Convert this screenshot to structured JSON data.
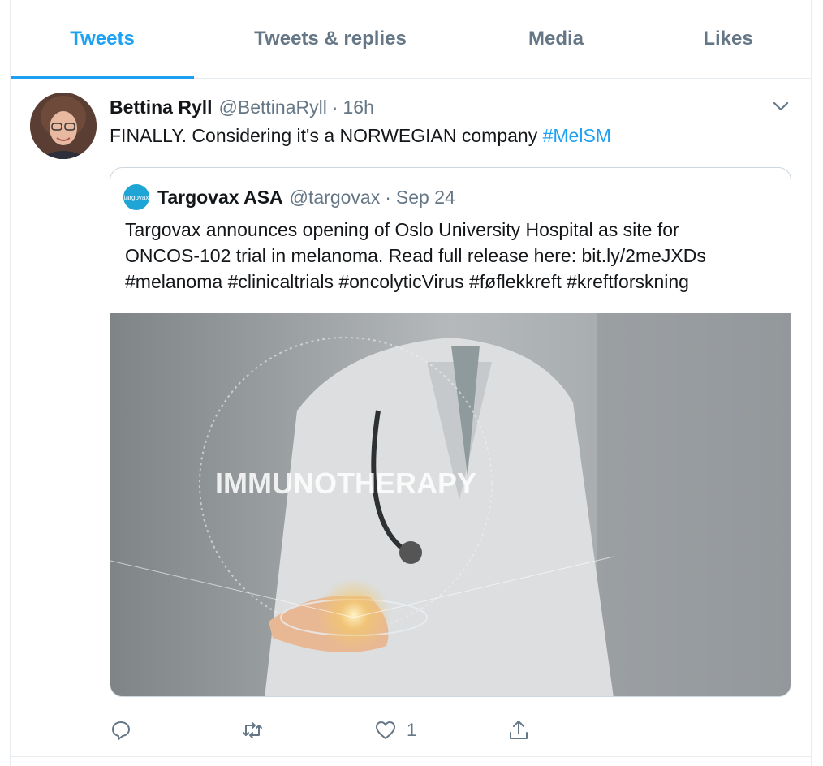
{
  "tabs": [
    {
      "label": "Tweets",
      "active": true
    },
    {
      "label": "Tweets & replies",
      "active": false
    },
    {
      "label": "Media",
      "active": false
    },
    {
      "label": "Likes",
      "active": false
    }
  ],
  "tweet": {
    "author_name": "Bettina Ryll",
    "author_handle": "@BettinaRyll",
    "separator": "·",
    "timestamp": "16h",
    "text": "FINALLY. Considering it's a NORWEGIAN company ",
    "hashtag": "#MelSM",
    "quoted": {
      "logo_text": "targovax",
      "author_name": "Targovax ASA",
      "author_handle": "@targovax",
      "separator": "·",
      "timestamp": "Sep 24",
      "text_line1": "Targovax announces opening of Oslo University Hospital as site for",
      "text_line2": "ONCOS-102 trial in melanoma. Read full release here:  bit.ly/2meJXDs",
      "text_line3": "#melanoma #clinicaltrials #oncolyticVirus #føflekkreft #kreftforskning",
      "image_overlay_text": "IMMUNOTHERAPY"
    },
    "actions": {
      "reply_icon": "reply-icon",
      "retweet_icon": "retweet-icon",
      "like_icon": "heart-icon",
      "like_count": "1",
      "share_icon": "share-icon"
    }
  },
  "colors": {
    "accent": "#1da1f2",
    "secondary_text": "#657786",
    "border": "#e6ecf0"
  }
}
